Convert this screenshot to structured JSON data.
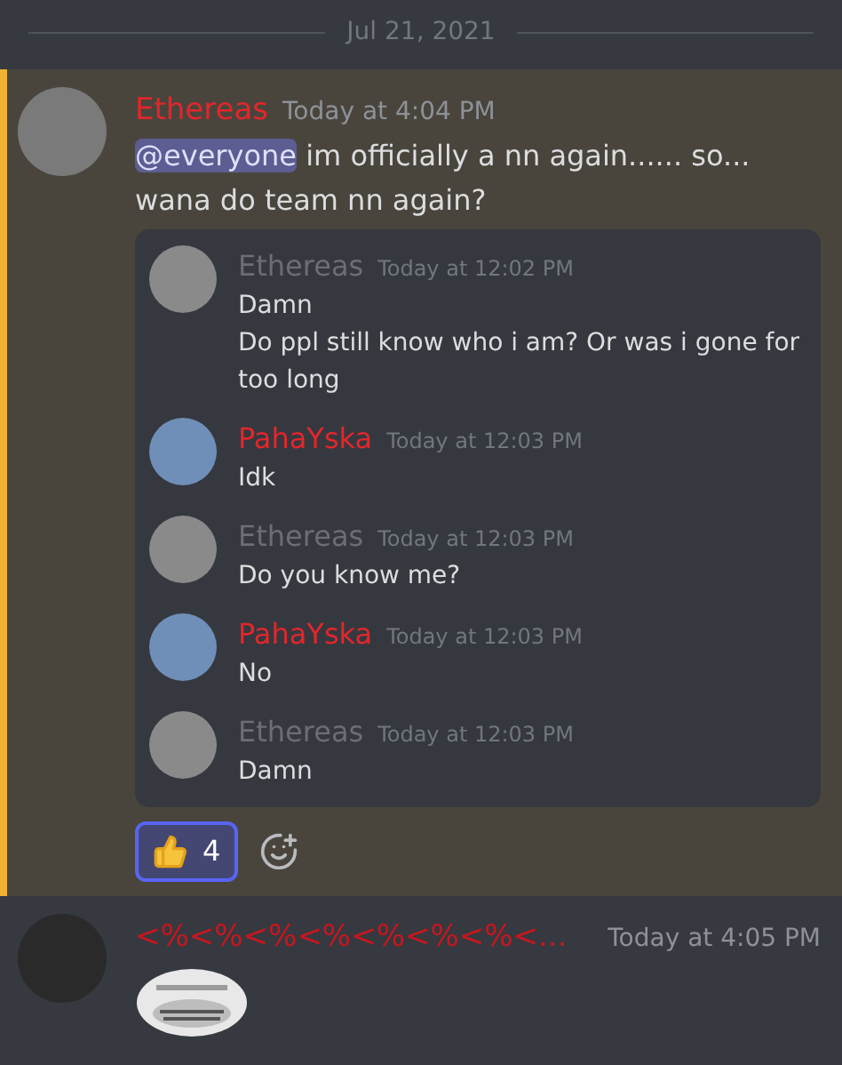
{
  "date_divider": "Jul 21, 2021",
  "messages": [
    {
      "author": "Ethereas",
      "color": "#e3262b",
      "timestamp": "Today at 4:04 PM",
      "highlighted": true,
      "content": [
        {
          "kind": "mention",
          "text": "@everyone"
        },
        {
          "kind": "text",
          "text": " im officially a nn again...... so... wana do team nn again?"
        }
      ],
      "quoted": [
        {
          "author": "Ethereas",
          "color": "#6c6e73",
          "timestamp": "Today at 12:02 PM",
          "lines": [
            "Damn",
            "Do ppl still know who i am? Or was i gone for too long"
          ]
        },
        {
          "author": "PahaYska",
          "color": "#e3262b",
          "timestamp": "Today at 12:03 PM",
          "lines": [
            "Idk"
          ]
        },
        {
          "author": "Ethereas",
          "color": "#6c6e73",
          "timestamp": "Today at 12:03 PM",
          "lines": [
            "Do you know me?"
          ]
        },
        {
          "author": "PahaYska",
          "color": "#e3262b",
          "timestamp": "Today at 12:03 PM",
          "lines": [
            "No"
          ]
        },
        {
          "author": "Ethereas",
          "color": "#6c6e73",
          "timestamp": "Today at 12:03 PM",
          "lines": [
            "Damn"
          ]
        }
      ],
      "reactions": [
        {
          "count": "4",
          "selected": true
        }
      ]
    },
    {
      "author": "<%<%<%<%<%<%<%<...",
      "color": "#c8161e",
      "timestamp": "Today at 4:05 PM",
      "highlighted": false
    }
  ]
}
